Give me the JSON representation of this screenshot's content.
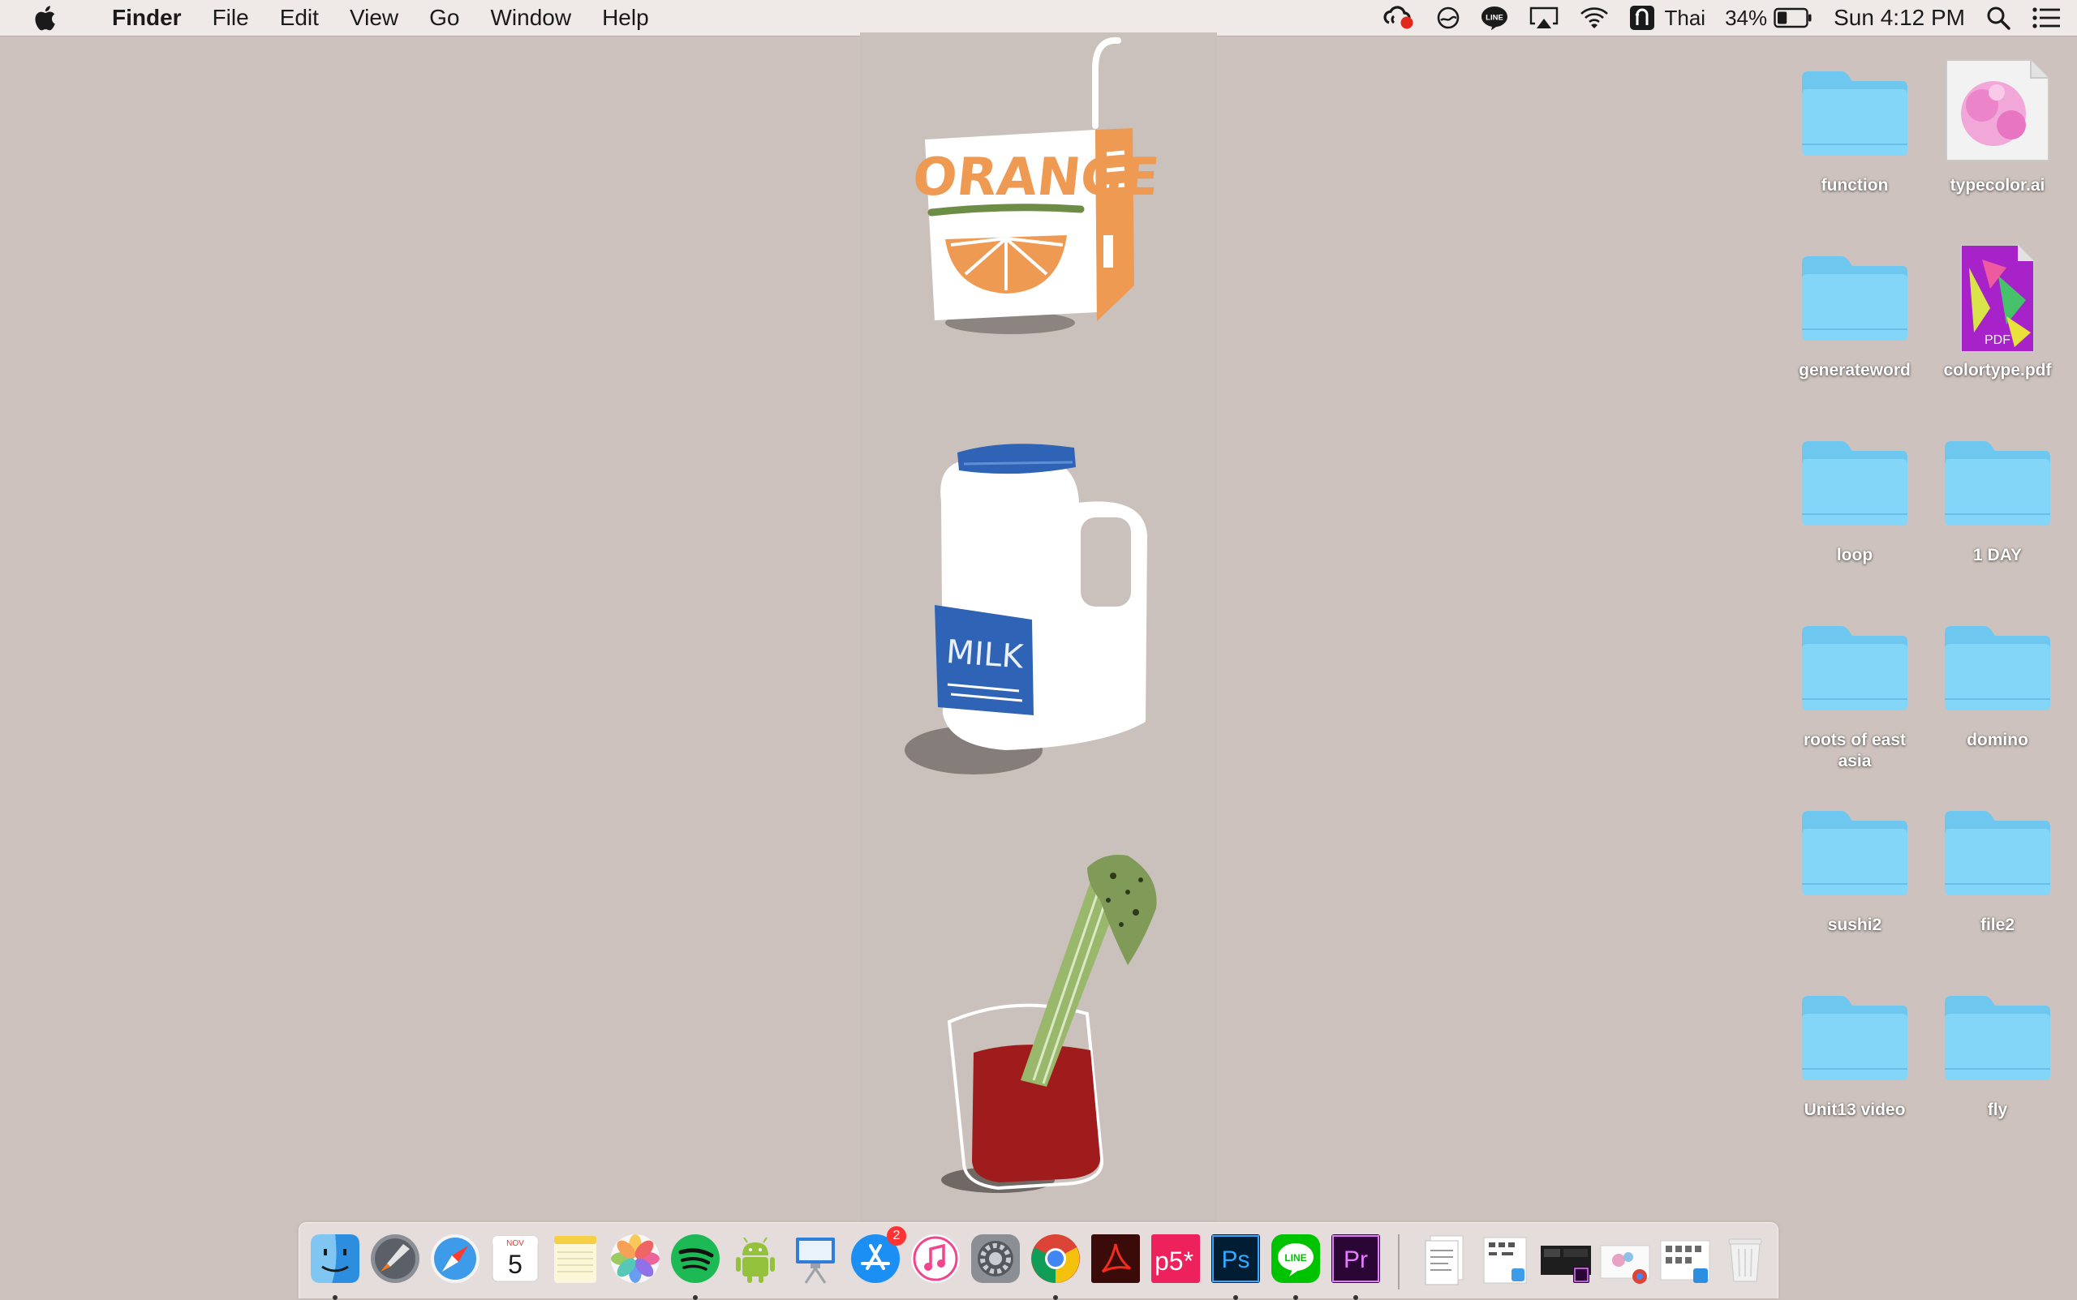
{
  "menubar": {
    "app_name": "Finder",
    "menus": [
      "File",
      "Edit",
      "View",
      "Go",
      "Window",
      "Help"
    ],
    "input_source": "Thai",
    "battery_percent": "34%",
    "battery_level": 0.34,
    "clock": "Sun 4:12 PM"
  },
  "wallpaper": {
    "carton_text": "ORANGE",
    "jug_text": "MILK"
  },
  "desktop": {
    "items": [
      {
        "label": "function",
        "type": "folder"
      },
      {
        "label": "typecolor.ai",
        "type": "ai-file"
      },
      {
        "label": "generateword",
        "type": "folder"
      },
      {
        "label": "colortype.pdf",
        "type": "pdf-file",
        "doc_label": "PDF"
      },
      {
        "label": "loop",
        "type": "folder"
      },
      {
        "label": "1 DAY",
        "type": "folder"
      },
      {
        "label": "roots of east asia",
        "type": "folder"
      },
      {
        "label": "domino",
        "type": "folder"
      },
      {
        "label": "sushi2",
        "type": "folder"
      },
      {
        "label": "file2",
        "type": "folder"
      },
      {
        "label": "Unit13 video",
        "type": "folder"
      },
      {
        "label": "fly",
        "type": "folder"
      }
    ]
  },
  "dock": {
    "calendar": {
      "month": "NOV",
      "day": "5"
    },
    "app_store_badge": "2",
    "p5_label": "p5*",
    "ps_label": "Ps",
    "pr_label": "Pr",
    "line_label": "LINE",
    "apps": [
      "finder",
      "launchpad",
      "safari",
      "calendar",
      "notes",
      "photos",
      "spotify",
      "android-studio",
      "keynote",
      "app-store",
      "itunes",
      "system-preferences",
      "chrome",
      "acrobat",
      "p5",
      "photoshop",
      "line",
      "premiere"
    ],
    "running": [
      "finder",
      "spotify",
      "chrome",
      "photoshop",
      "line",
      "premiere"
    ]
  },
  "colors": {
    "desktop_bg": "#cdc2bd",
    "folder": "#7fd3f6",
    "orange": "#ee9a52",
    "milk_blue": "#2f63b5",
    "tomato_red": "#a01b1b"
  }
}
